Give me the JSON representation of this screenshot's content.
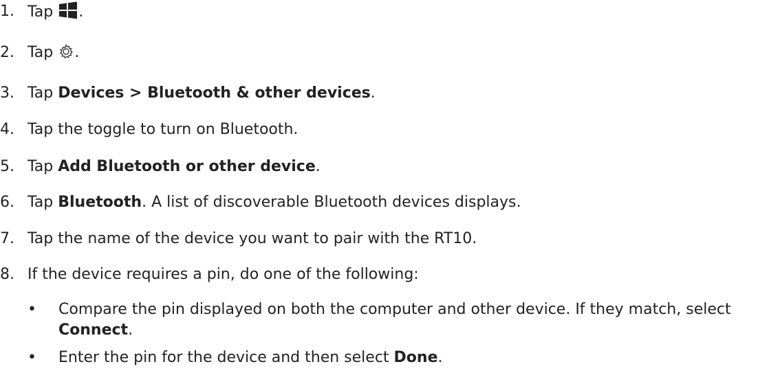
{
  "steps": [
    {
      "num": "1.",
      "pre": "Tap",
      "icon": "windows-start-icon",
      "post": "."
    },
    {
      "num": "2.",
      "pre": "Tap",
      "icon": "settings-gear-icon",
      "post": "."
    },
    {
      "num": "3.",
      "pre": "Tap",
      "bold": "Devices > Bluetooth & other devices",
      "post": "."
    },
    {
      "num": "4.",
      "text": "Tap the toggle to turn on Bluetooth."
    },
    {
      "num": "5.",
      "pre": "Tap",
      "bold": "Add Bluetooth or other device",
      "post": "."
    },
    {
      "num": "6.",
      "pre": "Tap",
      "bold": "Bluetooth",
      "post": ". A list of discoverable Bluetooth devices displays."
    },
    {
      "num": "7.",
      "text": "Tap the name of the device you want to pair with the RT10."
    },
    {
      "num": "8.",
      "text": "If the device requires a pin, do one of the following:"
    }
  ],
  "bullets": [
    {
      "bullet": "•",
      "pre": "Compare the pin displayed on both the computer and other device. If they match, select",
      "bold": "Connect",
      "post": "."
    },
    {
      "bullet": "•",
      "pre": "Enter the pin for the device and then select",
      "bold": "Done",
      "post": "."
    }
  ]
}
